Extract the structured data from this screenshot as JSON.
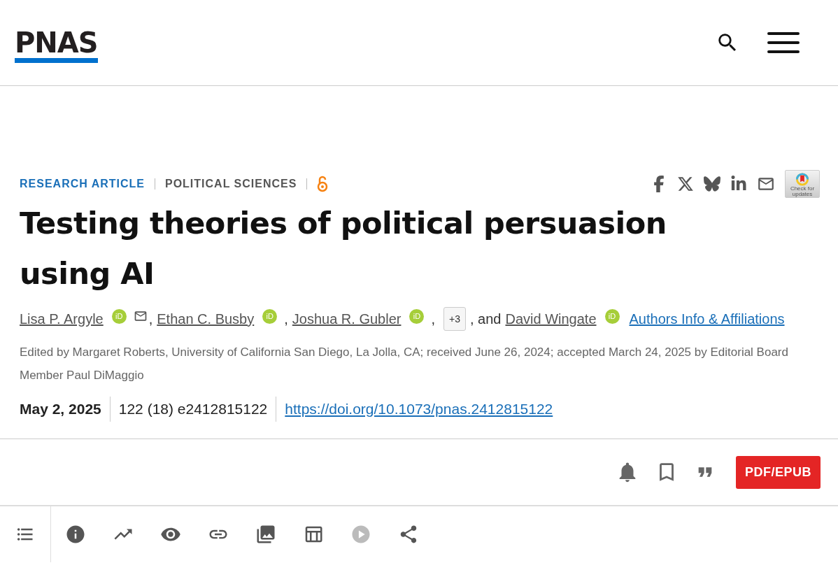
{
  "header": {
    "logo": "PNAS"
  },
  "tags": [
    {
      "label": "RESEARCH ARTICLE",
      "kind": "type"
    },
    {
      "label": "POLITICAL SCIENCES",
      "kind": "section"
    }
  ],
  "open_access": true,
  "share": [
    {
      "kind": "facebook"
    },
    {
      "kind": "x"
    },
    {
      "kind": "bluesky"
    },
    {
      "kind": "linkedin"
    },
    {
      "kind": "email"
    }
  ],
  "updates_badge": "Check for updates",
  "title": "Testing theories of political persuasion using AI",
  "authors": [
    {
      "name": "Lisa P. Argyle",
      "orcid": "iD",
      "email": true,
      "after": ","
    },
    {
      "name": "Ethan C. Busby",
      "orcid": "iD",
      "email": false,
      "after": ","
    },
    {
      "name": "Joshua R. Gubler",
      "orcid": "iD",
      "email": false,
      "after": ","
    },
    {
      "more": "+3",
      "after": ", and"
    },
    {
      "name": "David Wingate",
      "orcid": "iD",
      "email": false
    }
  ],
  "affiliations_link": "Authors Info & Affiliations",
  "edited": "Edited by Margaret Roberts, University of California San Diego, La Jolla, CA; received June 26, 2024; accepted March 24, 2025 by Editorial Board Member Paul DiMaggio",
  "date": "May 2, 2025",
  "citation": "122 (18) e2412815122",
  "doi": "https://doi.org/10.1073/pnas.2412815122",
  "actions": [
    {
      "kind": "alert"
    },
    {
      "kind": "bookmark"
    },
    {
      "kind": "cite"
    }
  ],
  "pdf_button": "PDF/EPUB",
  "toolbar": [
    {
      "kind": "contents",
      "disabled": false
    },
    {
      "kind": "info",
      "disabled": false
    },
    {
      "kind": "metrics",
      "disabled": false
    },
    {
      "kind": "view",
      "disabled": false
    },
    {
      "kind": "link",
      "disabled": false
    },
    {
      "kind": "figures",
      "disabled": false
    },
    {
      "kind": "tables",
      "disabled": false
    },
    {
      "kind": "media",
      "disabled": true
    },
    {
      "kind": "share",
      "disabled": false
    }
  ]
}
